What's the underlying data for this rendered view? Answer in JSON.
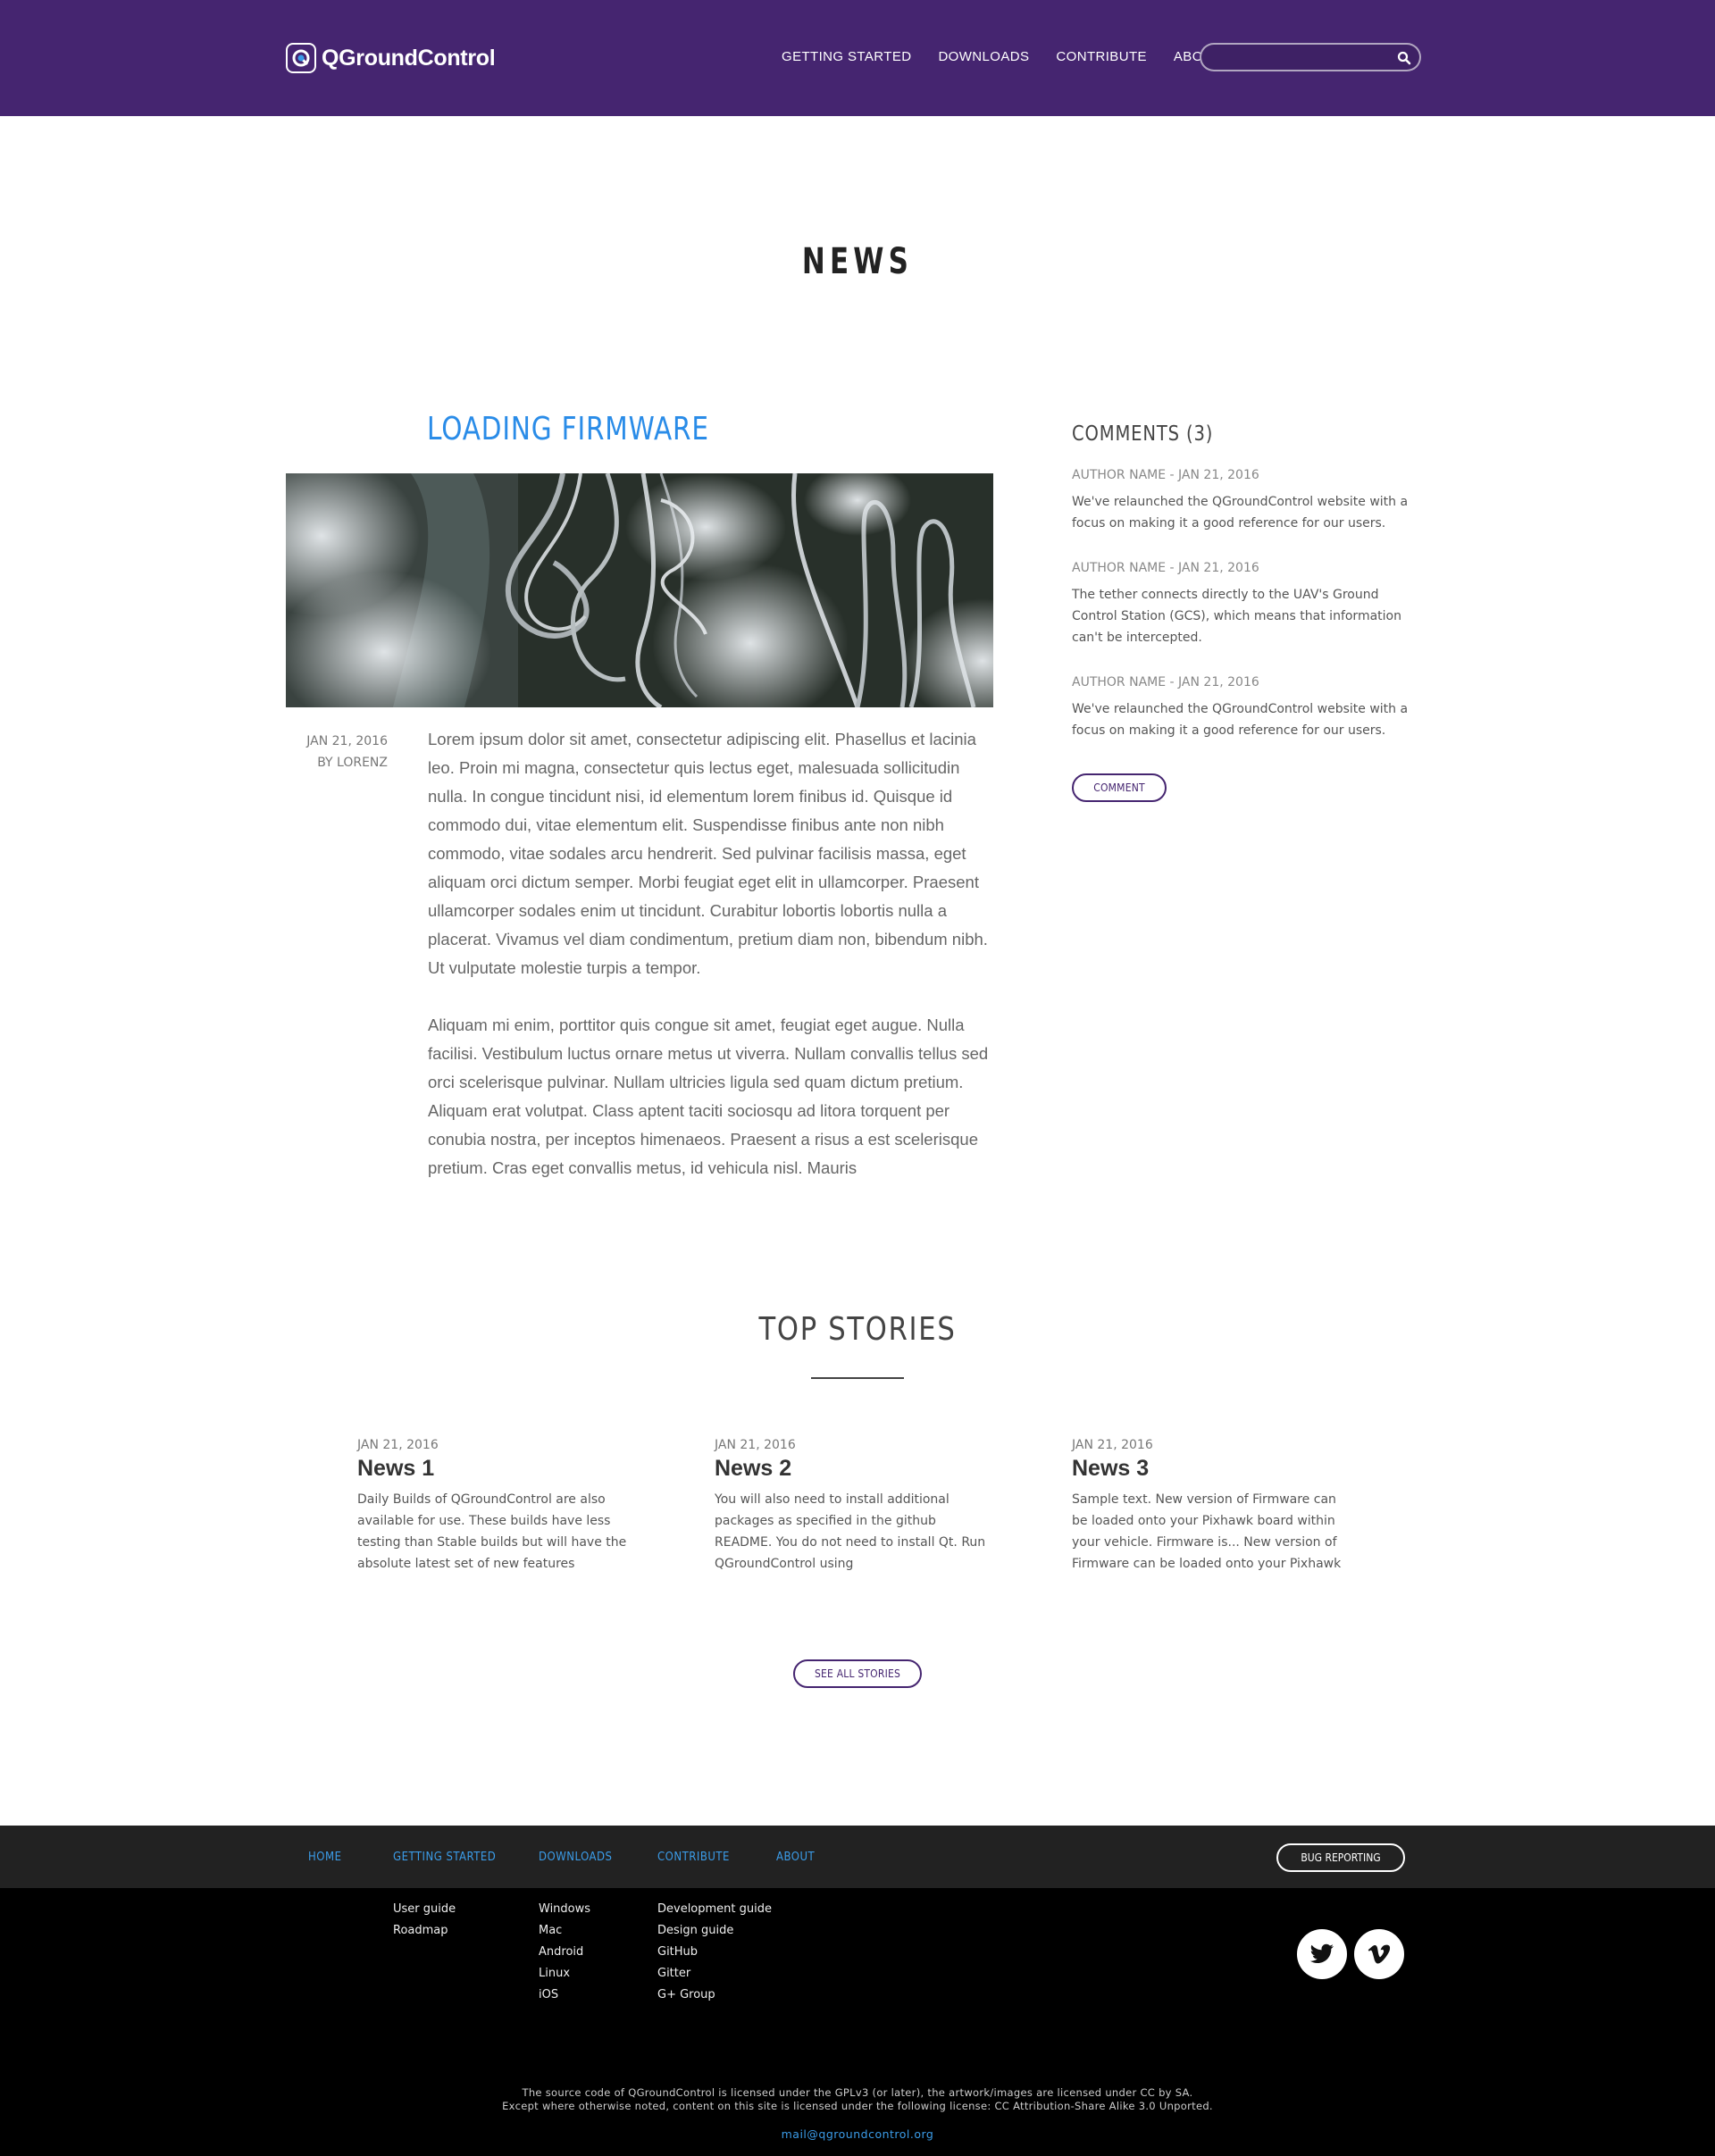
{
  "header": {
    "logo_text": "QGroundControl",
    "nav": [
      "GETTING STARTED",
      "DOWNLOADS",
      "CONTRIBUTE",
      "ABOUT"
    ],
    "search_placeholder": "",
    "bg_color": "#452570"
  },
  "page_title": "NEWS",
  "article": {
    "title": "LOADING FIRMWARE",
    "date": "JAN 21, 2016",
    "author": "BY LORENZ",
    "paragraphs": [
      "Lorem ipsum dolor sit amet, consectetur adipiscing elit. Phasellus et lacinia leo. Proin mi magna, consectetur quis lectus eget, malesuada sollicitudin nulla. In congue tincidunt nisi, id elementum lorem finibus id. Quisque id commodo dui, vitae elementum elit. Suspendisse finibus ante non nibh commodo, vitae sodales arcu hendrerit. Sed pulvinar facilisis massa, eget aliquam orci dictum semper. Morbi feugiat eget elit in ullamcorper. Praesent ullamcorper sodales enim ut tincidunt. Curabitur lobortis lobortis nulla a placerat. Vivamus vel diam condimentum, pretium diam non, bibendum nibh. Ut vulputate molestie turpis a tempor.",
      "Aliquam mi enim, porttitor quis congue sit amet, feugiat eget augue. Nulla facilisi. Vestibulum luctus ornare metus ut viverra. Nullam convallis tellus sed orci scelerisque pulvinar. Nullam ultricies ligula sed quam dictum pretium. Aliquam erat volutpat. Class aptent taciti sociosqu ad litora torquent per conubia nostra, per inceptos himenaeos. Praesent a risus a est scelerisque pretium. Cras eget convallis metus, id vehicula nisl. Mauris"
    ]
  },
  "comments": {
    "title": "COMMENTS (3)",
    "items": [
      {
        "meta": "AUTHOR NAME -  JAN 21, 2016",
        "text": "We've relaunched the QGroundControl website with a focus on making it a good reference for our users."
      },
      {
        "meta": "AUTHOR NAME -  JAN 21, 2016",
        "text": "The tether connects directly to the UAV's Ground Control Station (GCS), which means that information can't be intercepted."
      },
      {
        "meta": "AUTHOR NAME -  JAN 21, 2016",
        "text": "We've relaunched the QGroundControl website with a focus on making it a good reference for our users."
      }
    ],
    "button": "COMMENT"
  },
  "top_stories": {
    "title": "TOP STORIES",
    "items": [
      {
        "date": "JAN 21, 2016",
        "title": "News 1",
        "text": "Daily Builds of QGroundControl are also available for use. These builds have less testing than Stable builds but will have the absolute latest set of new features available."
      },
      {
        "date": "JAN 21, 2016",
        "title": "News 2",
        "text": "You will also need to install additional packages as specified in the github README. You do not need to install Qt. Run QGroundControl using"
      },
      {
        "date": "JAN 21, 2016",
        "title": "News 3",
        "text": "Sample text. New version of Firmware can be loaded onto your Pixhawk board within your vehicle. Firmware is... New version of Firmware can be loaded onto your Pixhawk"
      }
    ],
    "button": "SEE ALL STORIES"
  },
  "footer": {
    "nav": [
      "HOME",
      "GETTING STARTED",
      "DOWNLOADS",
      "CONTRIBUTE",
      "ABOUT"
    ],
    "bug_button": "BUG REPORTING",
    "getting_started_links": [
      "User guide",
      "Roadmap"
    ],
    "downloads_links": [
      "Windows",
      "Mac",
      "Android",
      "Linux",
      "iOS"
    ],
    "contribute_links": [
      "Development guide",
      "Design guide",
      "GitHub",
      "Gitter",
      "G+ Group"
    ],
    "social": [
      "twitter-icon",
      "vimeo-icon"
    ],
    "license_line1": "The source code of QGroundControl is licensed under the GPLv3 (or later), the artwork/images are licensed under CC by SA.",
    "license_line2": "Except where otherwise noted, content on this site is licensed under the following license: CC Attribution-Share Alike 3.0 Unported.",
    "email": "mail@qgroundcontrol.org",
    "link_color": "#3b9ce8"
  }
}
